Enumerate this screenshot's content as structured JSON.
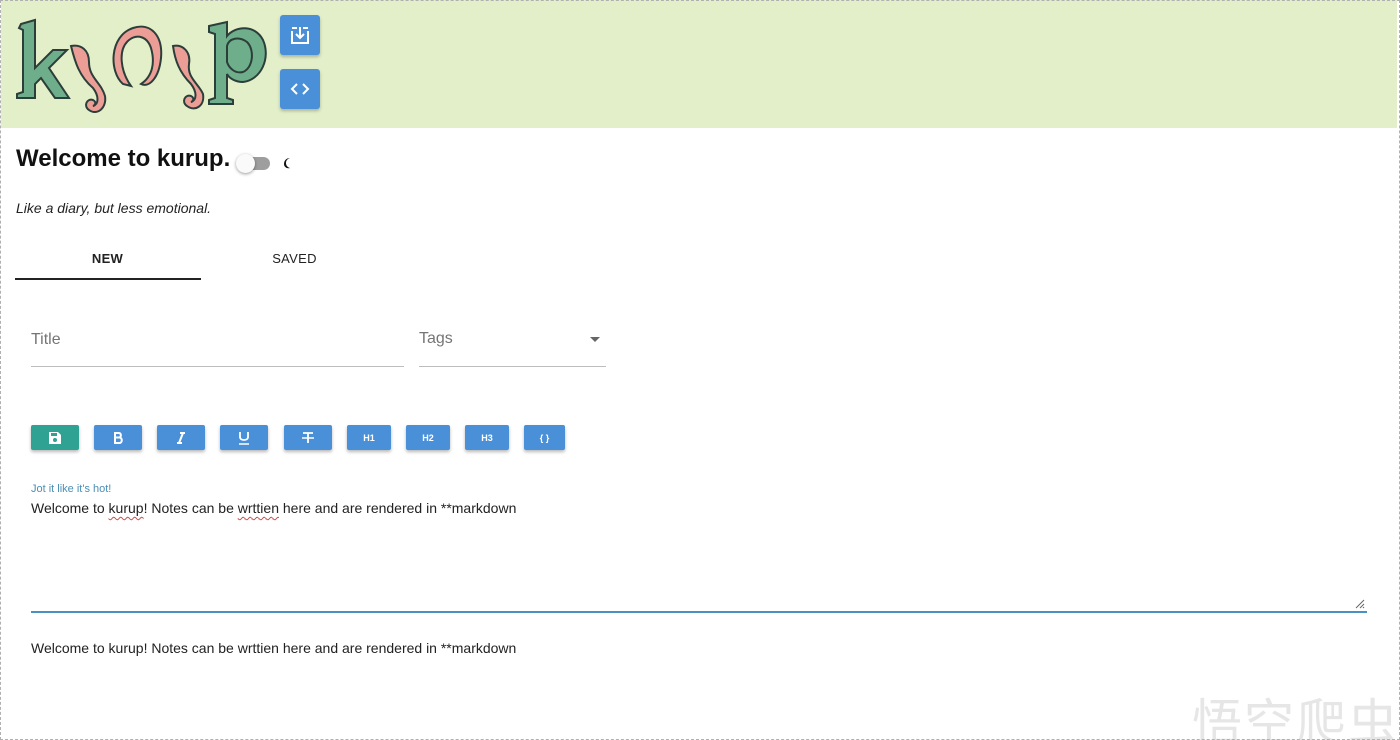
{
  "header": {
    "logo_text": "kurup",
    "export_icon": "download-box-icon",
    "embed_icon": "code-icon",
    "colors": {
      "background": "#e3efc9",
      "button": "#4a90d9",
      "logo_green": "#6fae8b",
      "logo_pink": "#ec9d95"
    }
  },
  "title": {
    "heading": "Welcome to kurup.",
    "subtitle": "Like a diary, but less emotional.",
    "theme_toggle_icon": "moon-icon"
  },
  "tabs": [
    {
      "label": "NEW",
      "active": true
    },
    {
      "label": "SAVED",
      "active": false
    }
  ],
  "form": {
    "title_placeholder": "Title",
    "title_value": "",
    "tags_label": "Tags"
  },
  "toolbar": {
    "save_icon": "save-icon",
    "bold_icon": "bold-icon",
    "italic_icon": "italic-icon",
    "underline_icon": "underline-icon",
    "strike_icon": "strikethrough-icon",
    "h1_label": "H1",
    "h2_label": "H2",
    "h3_label": "H3",
    "code_label": "{ }",
    "colors": {
      "save": "#2fa293",
      "format": "#4a90d9"
    }
  },
  "editor": {
    "label": "Jot it like it's hot!",
    "text_part1": "Welcome to ",
    "text_word1": "kurup",
    "text_part2": "! Notes can be ",
    "text_word2": "wrttien",
    "text_part3": " here and are rendered in **markdown"
  },
  "preview": {
    "text": "Welcome to kurup! Notes can be wrttien here and are rendered in **markdown"
  },
  "watermark": "悟空爬虫"
}
